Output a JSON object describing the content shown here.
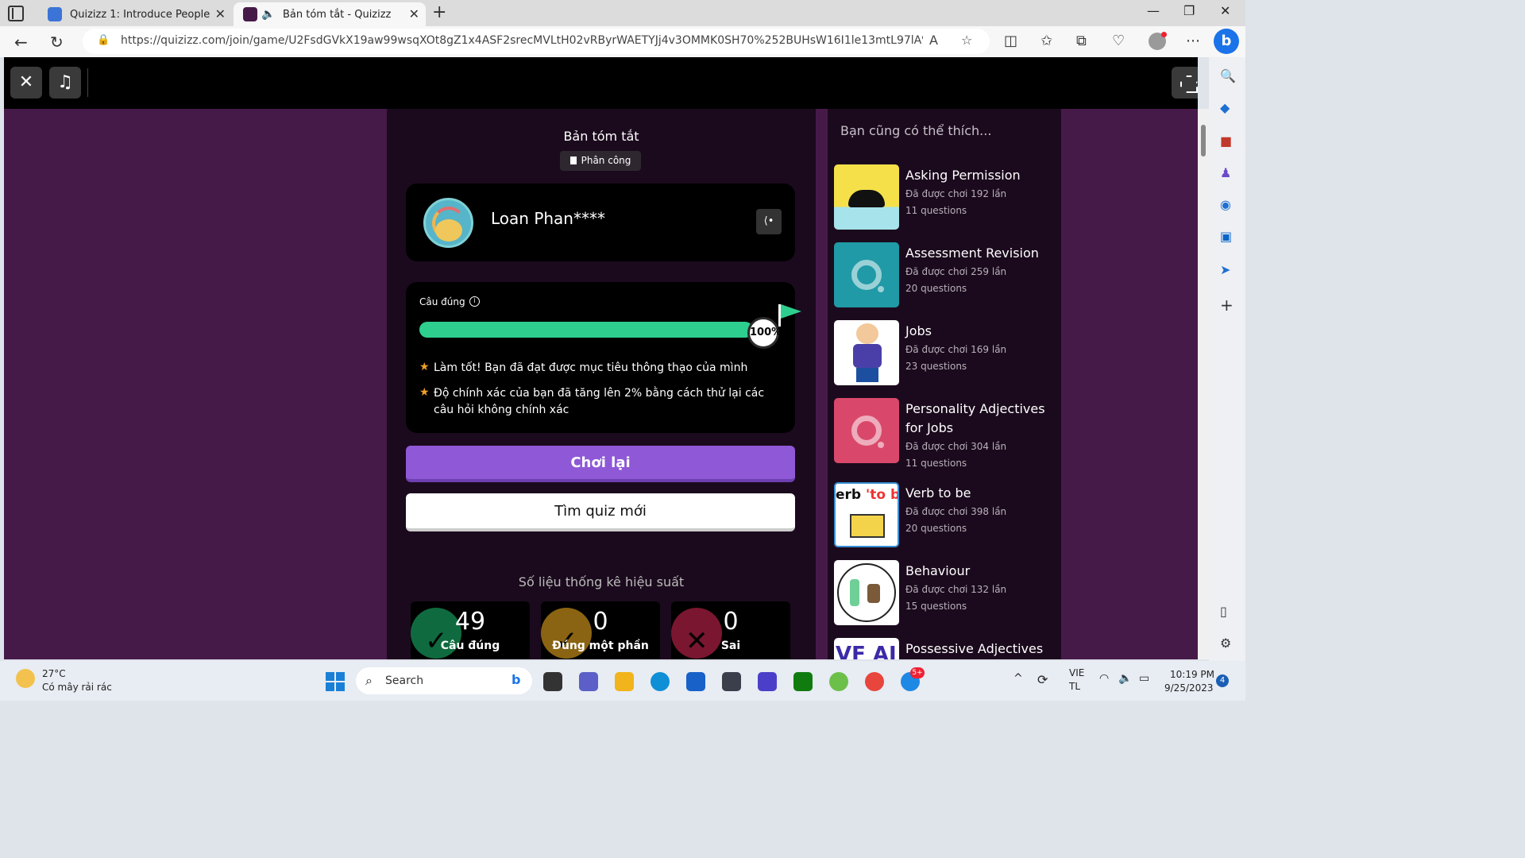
{
  "browser": {
    "tabs": [
      {
        "title": "Quizizz 1: Introduce People",
        "active": false
      },
      {
        "title": "Bản tóm tắt - Quizizz",
        "active": true
      }
    ],
    "url": "https://quizizz.com/join/game/U2FsdGVkX19aw99wsqXOt8gZ1x4ASF2srecMVLtH02vRByrWAETYJj4v3OMMK0SH70%252BUHsW16I1le13mtL97lA%253D%253..."
  },
  "summary": {
    "title": "Bản tóm tắt",
    "assignment_label": "Phân công",
    "user_name": "Loan Phan****",
    "accuracy_label": "Câu đúng",
    "accuracy_percent": 100,
    "accuracy_text": "100%",
    "bullets": [
      "Làm tốt! Bạn đã đạt được mục tiêu thông thạo của mình",
      "Độ chính xác của bạn đã tăng lên 2% bằng cách thử lại các câu hỏi không chính xác"
    ],
    "replay_label": "Chơi lại",
    "find_label": "Tìm quiz mới",
    "stats_title": "Số liệu thống kê hiệu suất",
    "stats": [
      {
        "value": "49",
        "label": "Câu đúng",
        "color": "#0f6b3f"
      },
      {
        "value": "0",
        "label": "Đúng một phần",
        "color": "#8a6412"
      },
      {
        "value": "0",
        "label": "Sai",
        "color": "#7a1630"
      }
    ]
  },
  "recommendations": {
    "title": "Bạn cũng có thể thích...",
    "items": [
      {
        "name": "Asking Permission",
        "played": "Đã được chơi 192 lần",
        "questions": "11 questions"
      },
      {
        "name": "Assessment Revision",
        "played": "Đã được chơi 259 lần",
        "questions": "20 questions"
      },
      {
        "name": "Jobs",
        "played": "Đã được chơi 169 lần",
        "questions": "23 questions"
      },
      {
        "name": "Personality Adjectives for Jobs",
        "played": "Đã được chơi 304 lần",
        "questions": "11 questions"
      },
      {
        "name": "Verb to be",
        "played": "Đã được chơi 398 lần",
        "questions": "20 questions"
      },
      {
        "name": "Behaviour",
        "played": "Đã được chơi 132 lần",
        "questions": "15 questions"
      },
      {
        "name": "Possessive Adjectives",
        "played": "",
        "questions": ""
      }
    ]
  },
  "taskbar": {
    "temperature": "27°C",
    "weather": "Có mây rải rác",
    "search_label": "Search",
    "language": "VIE",
    "layout": "TL",
    "time": "10:19 PM",
    "date": "9/25/2023",
    "notifications": "4",
    "zalo_badge": "5+"
  }
}
